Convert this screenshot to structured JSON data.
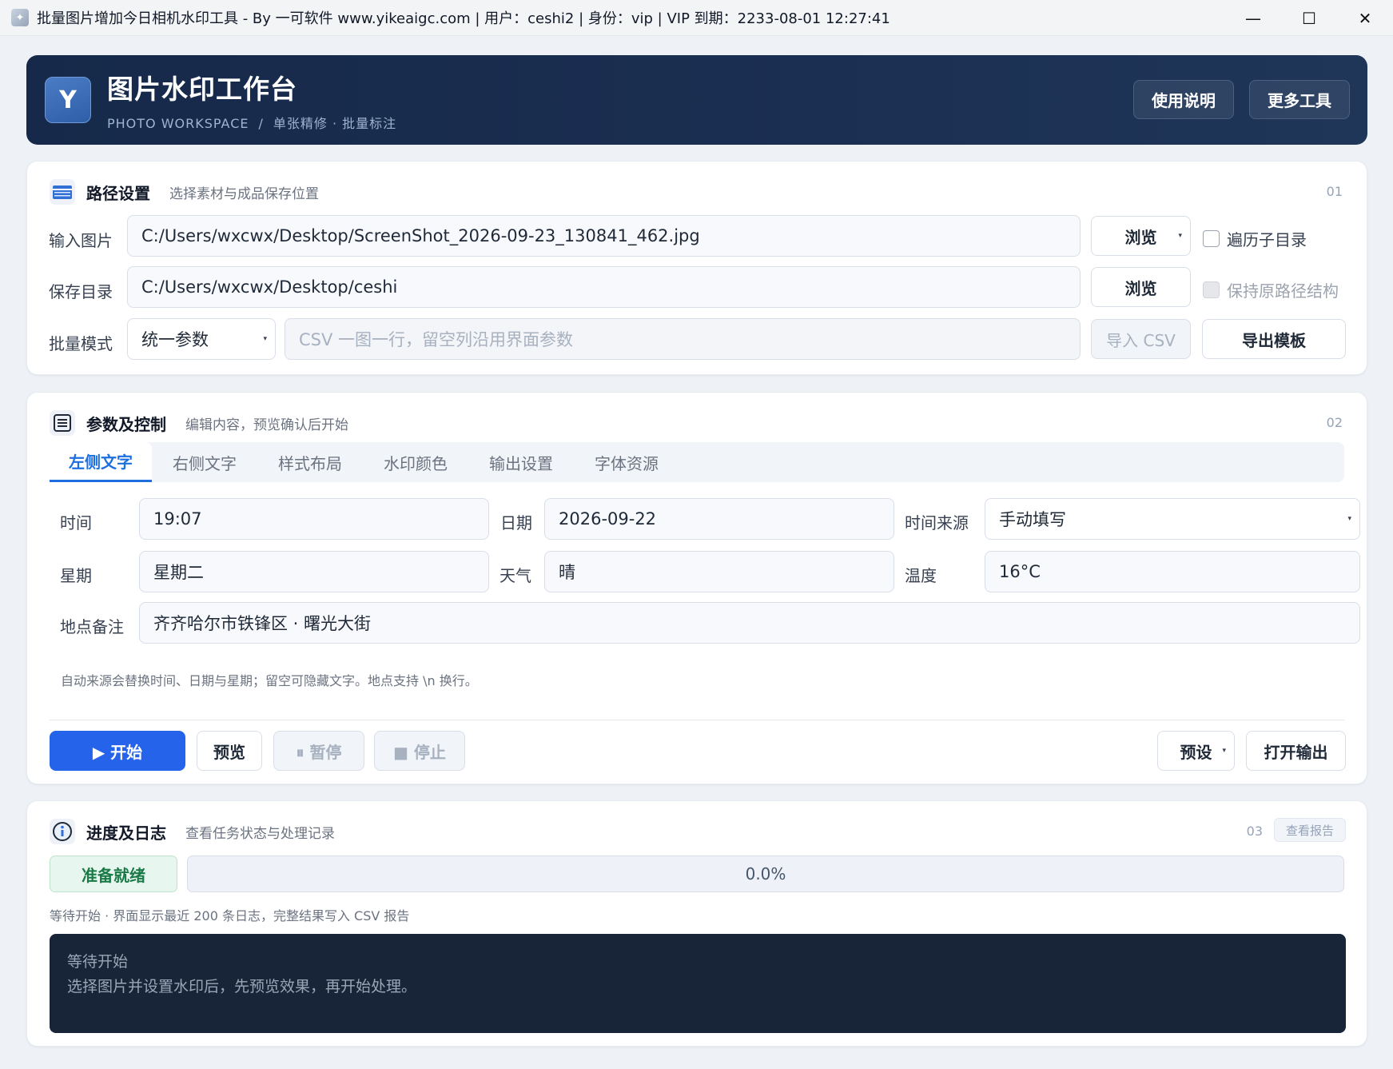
{
  "window": {
    "title": "批量图片增加今日相机水印工具 - By 一可软件 www.yikeaigc.com | 用户：ceshi2 | 身份：vip | VIP 到期：2233-08-01 12:27:41",
    "minimize": "—",
    "maximize": "☐",
    "close": "✕"
  },
  "header": {
    "logo_letter": "Y",
    "title": "图片水印工作台",
    "subtitle_en": "PHOTO WORKSPACE",
    "subtitle_sep": "/",
    "subtitle_items": "单张精修 · 批量标注",
    "help_button": "使用说明",
    "more_tools_button": "更多工具"
  },
  "path_section": {
    "title": "路径设置",
    "desc": "选择素材与成品保存位置",
    "number": "01",
    "input_label": "输入图片",
    "input_value": "C:/Users/wxcwx/Desktop/ScreenShot_2026-09-23_130841_462.jpg",
    "browse_input": "浏览",
    "traverse_subdirs": "遍历子目录",
    "save_label": "保存目录",
    "save_value": "C:/Users/wxcwx/Desktop/ceshi",
    "browse_save": "浏览",
    "keep_structure": "保持原路径结构",
    "batch_label": "批量模式",
    "batch_value": "统一参数",
    "csv_placeholder": "CSV 一图一行，留空列沿用界面参数",
    "import_csv": "导入 CSV",
    "export_template": "导出模板"
  },
  "params_section": {
    "title": "参数及控制",
    "desc": "编辑内容，预览确认后开始",
    "number": "02",
    "tabs": [
      "左侧文字",
      "右侧文字",
      "样式布局",
      "水印颜色",
      "输出设置",
      "字体资源"
    ],
    "time_label": "时间",
    "time_value": "19:07",
    "date_label": "日期",
    "date_value": "2026-09-22",
    "time_source_label": "时间来源",
    "time_source_value": "手动填写",
    "weekday_label": "星期",
    "weekday_value": "星期二",
    "weather_label": "天气",
    "weather_value": "晴",
    "temp_label": "温度",
    "temp_value": "16°C",
    "location_label": "地点备注",
    "location_value": "齐齐哈尔市铁锋区 · 曙光大街",
    "hint": "自动来源会替换时间、日期与星期；留空可隐藏文字。地点支持 \\n 换行。",
    "start": "▶ 开始",
    "preview": "预览",
    "pause": "⏸ 暂停",
    "stop": "■ 停止",
    "presets": "预设",
    "open_output": "打开输出"
  },
  "progress_section": {
    "title": "进度及日志",
    "desc": "查看任务状态与处理记录",
    "number": "03",
    "view_report": "查看报告",
    "status": "准备就绪",
    "progress_text": "0.0%",
    "progress_value": 0.0,
    "note": "等待开始 · 界面显示最近 200 条日志，完整结果写入 CSV 报告",
    "log_lines": [
      "等待开始",
      "选择图片并设置水印后，先预览效果，再开始处理。"
    ]
  },
  "colors": {
    "accent": "#2563eb",
    "header_bg": "#16294a",
    "status_green": "#1a7a47",
    "log_bg": "#182438"
  }
}
